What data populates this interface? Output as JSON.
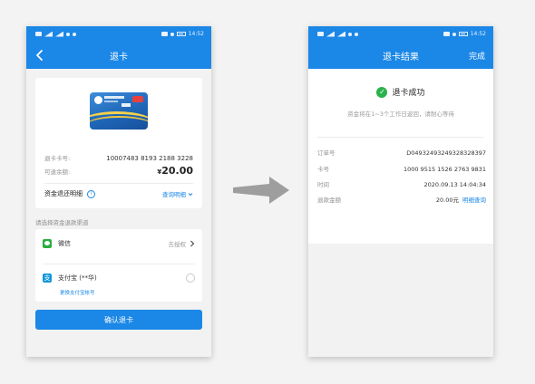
{
  "status_time": "14:52",
  "left_screen": {
    "title": "退卡",
    "card_number_label": "退卡卡号:",
    "card_number": "10007483 8193 2188 3228",
    "balance_label": "可退余额:",
    "balance_currency": "¥",
    "balance_amount": "20.00",
    "detail_title": "资金退还明细",
    "detail_link": "查询明细",
    "channel_prompt": "请选择资金退款渠道",
    "wechat_name": "微信",
    "wechat_status": "去授权",
    "alipay_name": "支付宝 (**华)",
    "change_alipay": "更换支付宝帐号",
    "confirm_button": "确认退卡"
  },
  "right_screen": {
    "title": "退卡结果",
    "done_button": "完成",
    "success_title": "退卡成功",
    "success_subtitle": "资金将在1~3个工作日返回，请耐心等待",
    "order_label": "订单号",
    "order_value": "D04932493249328328397",
    "card_label": "卡号",
    "card_value": "1000 9515 1526 2763 9831",
    "time_label": "时间",
    "time_value": "2020.09.13 14:04:34",
    "refund_label": "退款金额",
    "refund_value": "20.00元",
    "refund_link": "明细查询"
  },
  "colors": {
    "primary": "#1b87e6",
    "success": "#2ab34b",
    "wechat": "#2aae3d",
    "alipay": "#1296db"
  },
  "icons": [
    "back-arrow-icon",
    "info-icon",
    "chevron-down-icon",
    "wechat-icon",
    "alipay-icon",
    "chevron-right-icon",
    "success-check-icon",
    "flow-arrow-icon"
  ]
}
